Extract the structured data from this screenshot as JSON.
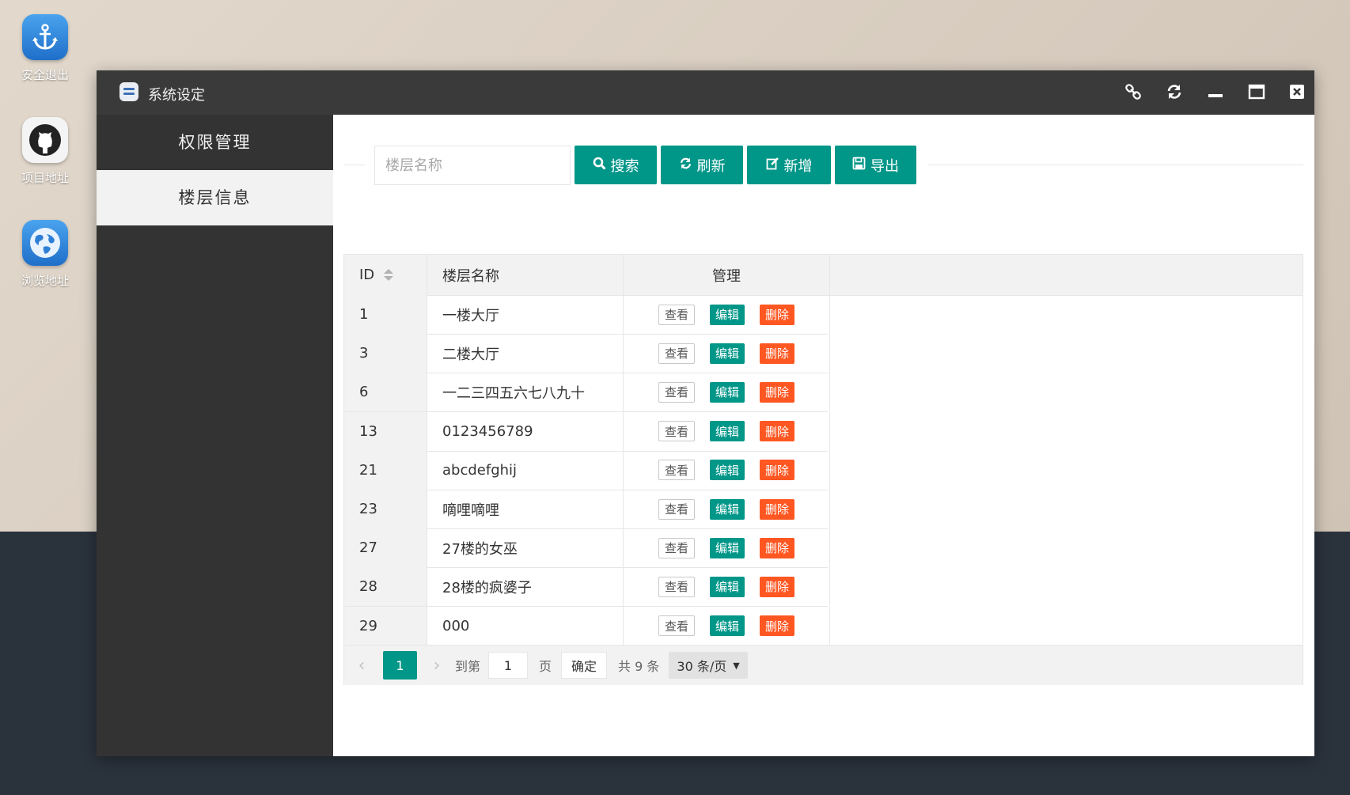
{
  "desktop": {
    "icons": [
      {
        "label": "安全退出",
        "icon": "anchor-icon"
      },
      {
        "label": "项目地址",
        "icon": "github-icon"
      },
      {
        "label": "浏览地址",
        "icon": "globe-icon"
      }
    ]
  },
  "window": {
    "title": "系统设定",
    "controls": [
      "link-icon",
      "refresh-icon",
      "minimize-icon",
      "maximize-icon",
      "close-icon"
    ]
  },
  "sidebar": {
    "items": [
      {
        "label": "权限管理",
        "active": false
      },
      {
        "label": "楼层信息",
        "active": true
      }
    ]
  },
  "toolbar": {
    "search_placeholder": "楼层名称",
    "search_value": "",
    "search_label": "搜索",
    "refresh_label": "刷新",
    "add_label": "新增",
    "export_label": "导出"
  },
  "table": {
    "headers": {
      "id": "ID",
      "name": "楼层名称",
      "manage": "管理"
    },
    "actions": {
      "view": "查看",
      "edit": "编辑",
      "delete": "删除"
    },
    "rows": [
      {
        "id": "1",
        "name": "一楼大厅"
      },
      {
        "id": "3",
        "name": "二楼大厅"
      },
      {
        "id": "6",
        "name": "一二三四五六七八九十"
      },
      {
        "id": "13",
        "name": "0123456789"
      },
      {
        "id": "21",
        "name": "abcdefghij"
      },
      {
        "id": "23",
        "name": "嘀哩嘀哩"
      },
      {
        "id": "27",
        "name": "27楼的女巫"
      },
      {
        "id": "28",
        "name": "28楼的疯婆子"
      },
      {
        "id": "29",
        "name": "000"
      }
    ]
  },
  "pagination": {
    "current": "1",
    "goto_label": "到第",
    "goto_value": "1",
    "page_label": "页",
    "confirm_label": "确定",
    "total_label": "共 9 条",
    "page_size": "30 条/页"
  },
  "colors": {
    "accent": "#009688",
    "danger": "#ff5722",
    "sidebar": "#333333",
    "titlebar": "#3a3a3a"
  }
}
